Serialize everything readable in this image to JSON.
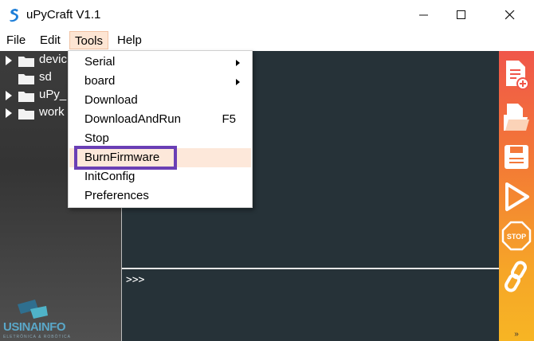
{
  "window": {
    "title": "uPyCraft V1.1",
    "minimize_glyph": "—",
    "maximize_glyph": "☐",
    "close_glyph": "✕"
  },
  "menubar": {
    "items": [
      {
        "label": "File"
      },
      {
        "label": "Edit"
      },
      {
        "label": "Tools"
      },
      {
        "label": "Help"
      }
    ],
    "active": "Tools"
  },
  "file_tree": {
    "items": [
      {
        "label": "devic",
        "expandable": true
      },
      {
        "label": "sd",
        "expandable": false
      },
      {
        "label": "uPy_",
        "expandable": true
      },
      {
        "label": "work",
        "expandable": true
      }
    ]
  },
  "tools_menu": {
    "items": [
      {
        "label": "Serial",
        "submenu": true,
        "shortcut": ""
      },
      {
        "label": "board",
        "submenu": true,
        "shortcut": ""
      },
      {
        "label": "Download",
        "submenu": false,
        "shortcut": ""
      },
      {
        "label": "DownloadAndRun",
        "submenu": false,
        "shortcut": "F5"
      },
      {
        "label": "Stop",
        "submenu": false,
        "shortcut": ""
      },
      {
        "label": "BurnFirmware",
        "submenu": false,
        "shortcut": ""
      },
      {
        "label": "InitConfig",
        "submenu": false,
        "shortcut": ""
      },
      {
        "label": "Preferences",
        "submenu": false,
        "shortcut": ""
      }
    ],
    "hovered": "BurnFirmware"
  },
  "terminal": {
    "prompt": ">>>"
  },
  "toolbar": {
    "buttons": [
      {
        "icon": "new-file-icon"
      },
      {
        "icon": "open-folder-icon"
      },
      {
        "icon": "save-icon"
      },
      {
        "icon": "run-icon"
      },
      {
        "icon": "stop-icon",
        "label": "STOP"
      },
      {
        "icon": "connect-icon"
      }
    ],
    "more_glyph": "»"
  },
  "logo": {
    "name": "USINAINFO",
    "tagline": "ELETRÔNICA & ROBÓTICA"
  },
  "colors": {
    "editor_bg": "#263238",
    "toolbar_top": "#f0564a",
    "toolbar_bottom": "#f7b524",
    "menu_hover": "#fde8da",
    "highlight": "#6a3fb5"
  }
}
